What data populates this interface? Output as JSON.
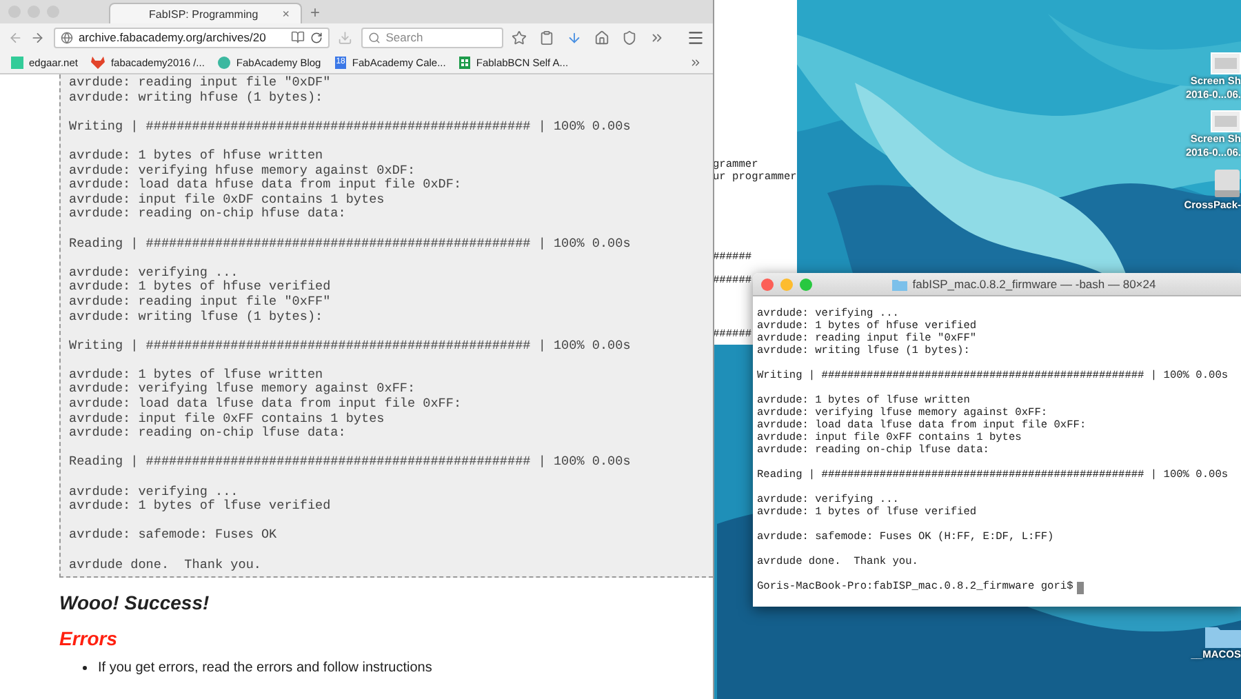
{
  "browser": {
    "tab_title": "FabISP: Programming",
    "tab_close": "×",
    "new_tab": "+",
    "url": "archive.fabacademy.org/archives/20",
    "search": {
      "placeholder": "Search"
    },
    "bookmarks": [
      {
        "kind": "square",
        "label": "edgaar.net"
      },
      {
        "kind": "fox",
        "label": "fabacademy2016 /..."
      },
      {
        "kind": "circle",
        "label": "FabAcademy Blog"
      },
      {
        "kind": "calendar",
        "badge": "18",
        "label": "FabAcademy Cale..."
      },
      {
        "kind": "sheet",
        "label": "FablabBCN Self A..."
      }
    ],
    "log_blocks": [
      [
        "avrdude: reading input file \"0xDF\"",
        "avrdude: writing hfuse (1 bytes):"
      ],
      [
        "Writing | ################################################## | 100% 0.00s"
      ],
      [
        "avrdude: 1 bytes of hfuse written",
        "avrdude: verifying hfuse memory against 0xDF:",
        "avrdude: load data hfuse data from input file 0xDF:",
        "avrdude: input file 0xDF contains 1 bytes",
        "avrdude: reading on-chip hfuse data:"
      ],
      [
        "Reading | ################################################## | 100% 0.00s"
      ],
      [
        "avrdude: verifying ...",
        "avrdude: 1 bytes of hfuse verified",
        "avrdude: reading input file \"0xFF\"",
        "avrdude: writing lfuse (1 bytes):"
      ],
      [
        "Writing | ################################################## | 100% 0.00s"
      ],
      [
        "avrdude: 1 bytes of lfuse written",
        "avrdude: verifying lfuse memory against 0xFF:",
        "avrdude: load data lfuse data from input file 0xFF:",
        "avrdude: input file 0xFF contains 1 bytes",
        "avrdude: reading on-chip lfuse data:"
      ],
      [
        "Reading | ################################################## | 100% 0.00s"
      ],
      [
        "avrdude: verifying ...",
        "avrdude: 1 bytes of lfuse verified"
      ],
      [
        "avrdude: safemode: Fuses OK"
      ],
      [
        "avrdude done.  Thank you."
      ]
    ],
    "success_heading": "Wooo! Success!",
    "errors_heading": "Errors",
    "bullet": "If you get errors, read the errors and follow instructions"
  },
  "background_window": {
    "lines": [
      "grammer",
      "ur programmer",
      "######",
      "######",
      "######"
    ]
  },
  "desktop_icons": [
    {
      "kind": "screenshot",
      "label": [
        "Screen Sh",
        "2016-0...06."
      ]
    },
    {
      "kind": "screenshot",
      "label": [
        "Screen Sh",
        "2016-0...06."
      ]
    },
    {
      "kind": "disk",
      "label": [
        "CrossPack-"
      ]
    },
    {
      "kind": "folder",
      "label": [
        "__MACOS"
      ]
    }
  ],
  "terminal": {
    "title": "fabISP_mac.0.8.2_firmware — -bash — 80×24",
    "blocks": [
      [
        "avrdude: verifying ...",
        "avrdude: 1 bytes of hfuse verified",
        "avrdude: reading input file \"0xFF\"",
        "avrdude: writing lfuse (1 bytes):"
      ],
      [
        "Writing | ################################################## | 100% 0.00s"
      ],
      [
        "avrdude: 1 bytes of lfuse written",
        "avrdude: verifying lfuse memory against 0xFF:",
        "avrdude: load data lfuse data from input file 0xFF:",
        "avrdude: input file 0xFF contains 1 bytes",
        "avrdude: reading on-chip lfuse data:"
      ],
      [
        "Reading | ################################################## | 100% 0.00s"
      ],
      [
        "avrdude: verifying ...",
        "avrdude: 1 bytes of lfuse verified"
      ],
      [
        "avrdude: safemode: Fuses OK (H:FF, E:DF, L:FF)"
      ],
      [
        "avrdude done.  Thank you."
      ]
    ],
    "prompt": "Goris-MacBook-Pro:fabISP_mac.0.8.2_firmware gori$"
  }
}
